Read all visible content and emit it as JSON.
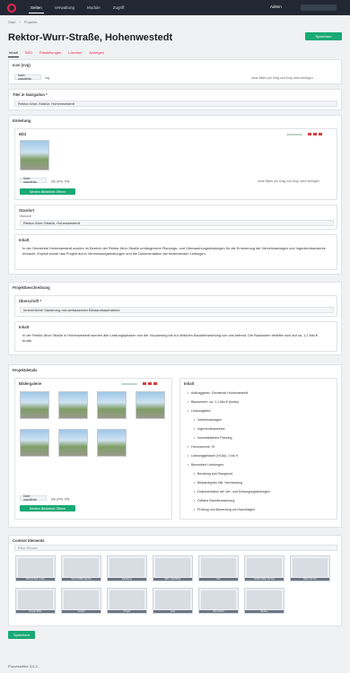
{
  "topbar": {
    "nav": [
      "Seiten",
      "Verwaltung",
      "Module",
      "Zugriff"
    ],
    "admin": "Admin"
  },
  "breadcrumb": [
    "Start",
    "Projekte"
  ],
  "page": {
    "title": "Rektor-Wurr-Straße, Hohenwestedt",
    "save": "Speichern"
  },
  "tabs": [
    "Inhalt",
    "SEO",
    "Einstellungen",
    "Löschen",
    "Anzeigen"
  ],
  "icon_panel": {
    "label": "Icon (svg)",
    "file_button": "Datei auswählen",
    "ext": "svg",
    "drop_hint": "neue Bilder per Drag und Drop oben einfügen"
  },
  "nav_title": {
    "label": "Titel in Navigation *",
    "value": "Rektor-Wurr-Straße, Hohenwestedt"
  },
  "einleitung": {
    "label": "Einleitung",
    "bild_label": "Bild",
    "file_button": "Datei auswählen",
    "ext": "jpg, jpeg, png",
    "drop_hint": "neue Bilder per Drag und Drop oben einfügen",
    "media_button": "Medien Bibliothek Öffnen"
  },
  "standort": {
    "label": "Standort",
    "field_label": "Standort",
    "value": "Rektor-Wurr-Straße, Hohenwestedt"
  },
  "inhalt1": {
    "label": "Inhalt",
    "text": "In der Gemeinde Hohenwestedt wurden im Bereich der Rektor-Wurr-Straße umfangreiche Planungs- und Überwachungsleistungen für die Erneuerung der Verkehrsanlagen und Ingenieurbauwerke erbracht. Explizit wurde das Projekt durch Vermessungsleistungen und die Dokumentation der bestehenden Leitungen."
  },
  "projektbeschreibung": {
    "label": "Projektbeschreibung",
    "ueberschrift_label": "Überschrift *",
    "ueberschrift": "Innerörtliche Sanierung mit umfassender Bestandsaufnahme",
    "inhalt_label": "Inhalt",
    "text": "In der Rektor-Wurr-Straße in Hohenwestedt wurden alle Leistungsphasen von der Vorplanung bis zur örtlichen Bauüberwachung von uns betreut. Die Baukosten beliefen sich auf ca. 1,1 Mio.€ brutto."
  },
  "projektdetails": {
    "label": "Projektdetails",
    "galerie_label": "Bildergalerie",
    "file_button": "Datei auswählen",
    "ext": "jpg, jpeg, png",
    "media_button": "Medien Bibliothek Öffnen",
    "inhalt_label": "Inhalt",
    "list": [
      {
        "text": "Auftraggeber: Gemeinde Hohenwestedt",
        "sub": false
      },
      {
        "text": "Bausumme: ca. 1,1 Mio.€ (brutto)",
        "sub": false
      },
      {
        "text": "Leistungsbild:",
        "sub": false
      },
      {
        "text": "Verkehrsanlagen",
        "sub": true
      },
      {
        "text": "Ingenieurbauwerke",
        "sub": true
      },
      {
        "text": "Innerstädtische Planung",
        "sub": true
      },
      {
        "text": "Honorarzone: III",
        "sub": false
      },
      {
        "text": "Leistungsphasen (HOAI): 1 bis 9",
        "sub": false
      },
      {
        "text": "Besondere Leistungen:",
        "sub": false
      },
      {
        "text": "Beratung zum Baugrund",
        "sub": true
      },
      {
        "text": "Bestandsplan inkl. Vermessung",
        "sub": true
      },
      {
        "text": "Dokumentation der Ver- und Entsorgungsleitungen",
        "sub": true
      },
      {
        "text": "Örtliche Bauüberwachung",
        "sub": true
      },
      {
        "text": "Prüfung und Bewertung von Nachträgen",
        "sub": true
      }
    ]
  },
  "content_elements": {
    "label": "Content Elements",
    "filter_placeholder": "Filter Blocks",
    "blocks": [
      "Bild mit Text / Links",
      "Text mit Bild / Rechts",
      "Einleitung",
      "Bild + Text Block",
      "Text",
      "Großer Slider mit Text",
      "Slider mit Text",
      "Projekt Slider",
      "Textfeld",
      "Projekt",
      "Links",
      "Mit Textfeld",
      "Weitere"
    ]
  },
  "footer": "ProcessWire 3.0.2..."
}
